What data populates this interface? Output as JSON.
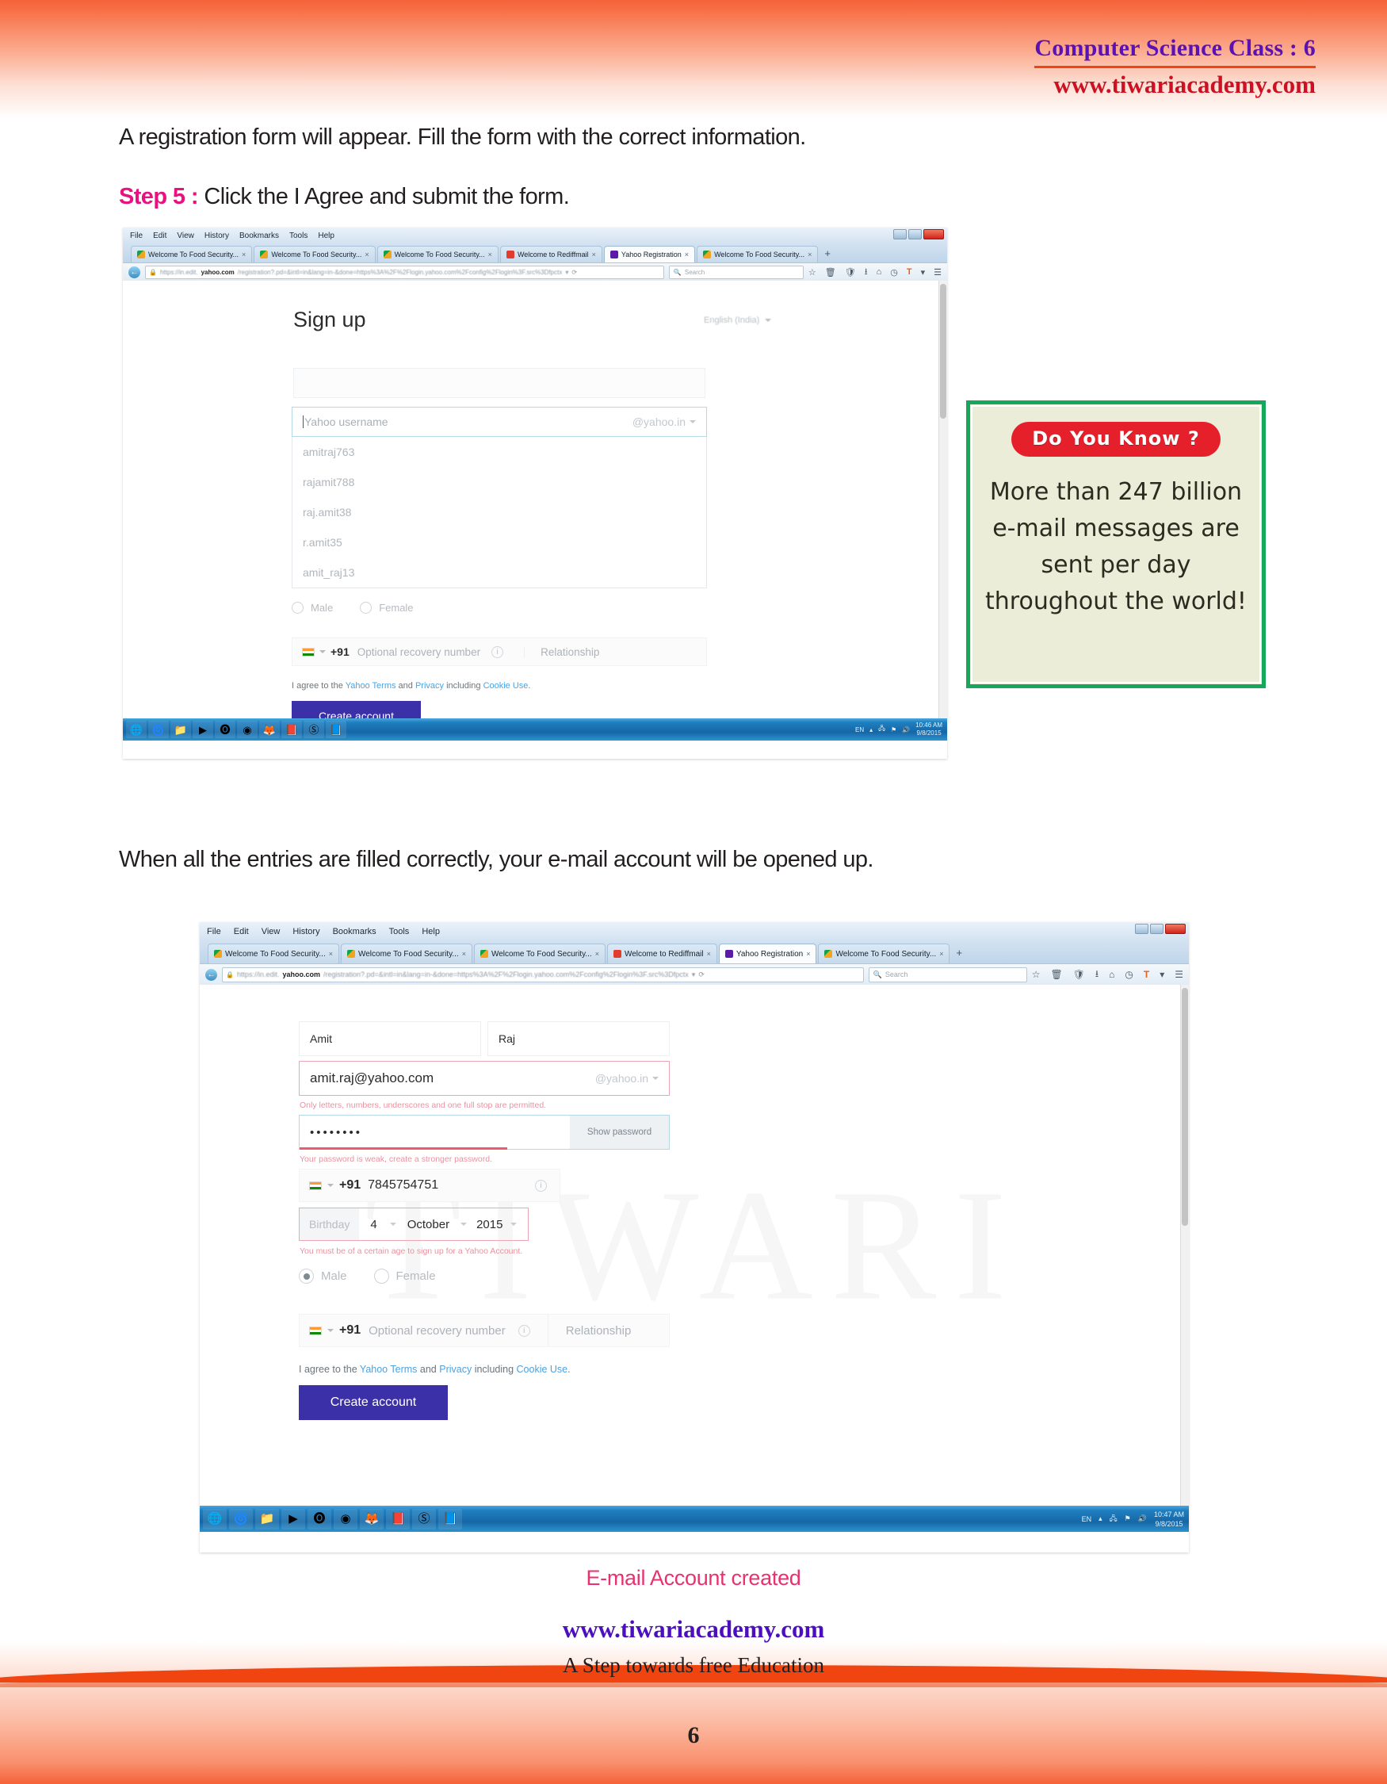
{
  "header": {
    "title": "Computer Science Class : 6",
    "website": "www.tiwariacademy.com"
  },
  "body": {
    "intro": "A registration form will appear. Fill the form with the correct information.",
    "step5_label": "Step 5 :",
    "step5_text": "Click the I Agree and submit the form.",
    "middle": "When all the entries are filled correctly, your e-mail account will be opened up."
  },
  "didyouknow": {
    "pill": "Do You Know ?",
    "text": "More than 247 billion e-mail messages are sent per day throughout the world!",
    "border_color": "#16a75c",
    "bg_color": "#ecedd8",
    "pill_color": "#e5202b"
  },
  "captions": {
    "email_created": "E-mail Account created"
  },
  "footer": {
    "url": "www.tiwariacademy.com",
    "tagline": "A Step towards free Education",
    "page_number": "6"
  },
  "browser": {
    "menu": [
      "File",
      "Edit",
      "View",
      "History",
      "Bookmarks",
      "Tools",
      "Help"
    ],
    "tabs": [
      {
        "label": "Welcome To Food Security...",
        "favicon": "fav-green",
        "active": false
      },
      {
        "label": "Welcome To Food Security...",
        "favicon": "fav-green",
        "active": false
      },
      {
        "label": "Welcome To Food Security...",
        "favicon": "fav-green",
        "active": false
      },
      {
        "label": "Welcome to Rediffmail",
        "favicon": "fav-red",
        "active": false
      },
      {
        "label": "Yahoo Registration",
        "favicon": "fav-purple",
        "active": true
      },
      {
        "label": "Welcome To Food Security...",
        "favicon": "fav-green",
        "active": false
      }
    ],
    "new_tab": "+",
    "url_host": "yahoo.com",
    "url_prefix": "https://in.edit.",
    "url_rest": "/registration?.pd=&intl=in&lang=in-&done=https%3A%2F%2Flogin.yahoo.com%2Fconfig%2Flogin%3F.src%3Dfpctx",
    "search_placeholder": "Search",
    "toolbar_icons": [
      "star-icon",
      "trash-icon",
      "shield-icon",
      "download-icon",
      "home-icon",
      "clock-icon",
      "T-icon",
      "menu-icon"
    ]
  },
  "screenshot1": {
    "signup_title": "Sign up",
    "language": "English (India)",
    "username_placeholder": "Yahoo username",
    "domain_suffix": "@yahoo.in",
    "suggestions": [
      "amitraj763",
      "rajamit788",
      "raj.amit38",
      "r.amit35",
      "amit_raj13"
    ],
    "gender": {
      "male": "Male",
      "female": "Female",
      "selected": "none"
    },
    "recovery": {
      "code": "+91",
      "placeholder": "Optional recovery number",
      "relationship": "Relationship"
    },
    "agree": {
      "prefix": "I agree to the ",
      "terms": "Yahoo Terms",
      "mid": " and ",
      "privacy": "Privacy",
      "mid2": " including ",
      "cookie": "Cookie Use",
      "suffix": "."
    },
    "create_button": "Create account",
    "taskbar": {
      "lang": "EN",
      "time": "10:46 AM",
      "date": "9/8/2015"
    }
  },
  "screenshot2": {
    "first_name": "Amit",
    "last_name": "Raj",
    "email_value": "amit.raj@yahoo.com",
    "domain_suffix": "@yahoo.in",
    "email_error": "Only letters, numbers, underscores and one full stop are permitted.",
    "password_value": "••••••••",
    "show_password": "Show password",
    "password_error": "Your password is weak, create a stronger password.",
    "phone": {
      "code": "+91",
      "number": "7845754751"
    },
    "birthday": {
      "label": "Birthday",
      "day": "4",
      "month": "October",
      "year": "2015"
    },
    "birthday_error": "You must be of a certain age to sign up for a Yahoo Account.",
    "gender": {
      "male": "Male",
      "female": "Female",
      "selected": "male"
    },
    "recovery": {
      "code": "+91",
      "placeholder": "Optional recovery number",
      "relationship": "Relationship"
    },
    "agree": {
      "prefix": "I agree to the ",
      "terms": "Yahoo Terms",
      "mid": " and ",
      "privacy": "Privacy",
      "mid2": " including ",
      "cookie": "Cookie Use",
      "suffix": "."
    },
    "create_button": "Create account",
    "taskbar": {
      "lang": "EN",
      "time": "10:47 AM",
      "date": "9/8/2015"
    },
    "watermark": "TIWARI"
  }
}
